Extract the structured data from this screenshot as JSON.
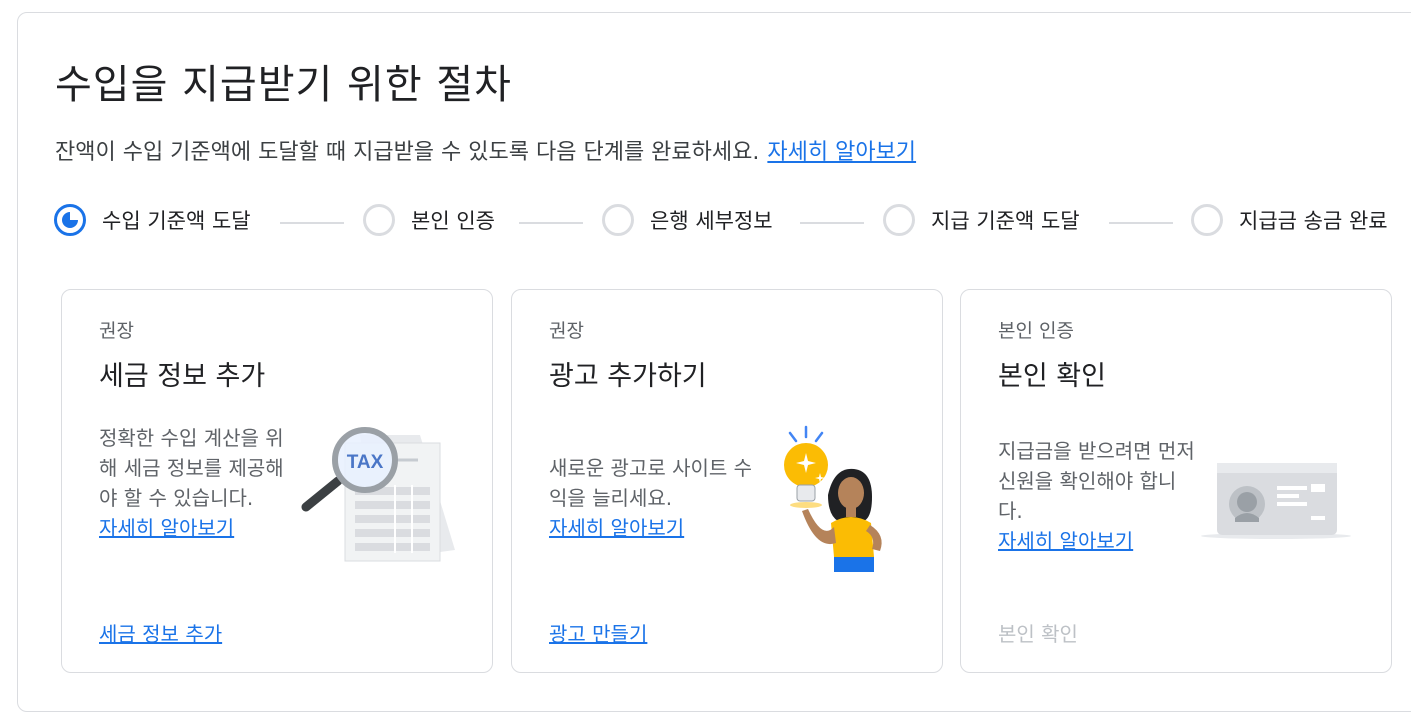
{
  "header": {
    "title": "수입을 지급받기 위한 절차",
    "subtitle": "잔액이 수입 기준액에 도달할 때 지급받을 수 있도록 다음 단계를 완료하세요.",
    "learn_more": "자세히 알아보기"
  },
  "steps": [
    {
      "label": "수입 기준액 도달",
      "state": "in-progress"
    },
    {
      "label": "본인 인증",
      "state": "pending"
    },
    {
      "label": "은행 세부정보",
      "state": "pending"
    },
    {
      "label": "지급 기준액 도달",
      "state": "pending"
    },
    {
      "label": "지급금 송금 완료",
      "state": "pending"
    }
  ],
  "cards": [
    {
      "eyebrow": "권장",
      "title": "세금 정보 추가",
      "description": "정확한 수입 계산을 위해 세금 정보를 제공해야 할 수 있습니다.",
      "learn_more": "자세히 알아보기",
      "action": "세금 정보 추가",
      "action_enabled": true,
      "illustration_icon": "tax-document-magnifier-icon",
      "illustration_text": "TAX"
    },
    {
      "eyebrow": "권장",
      "title": "광고 추가하기",
      "description": "새로운 광고로 사이트 수익을 늘리세요.",
      "learn_more": "자세히 알아보기",
      "action": "광고 만들기",
      "action_enabled": true,
      "illustration_icon": "lightbulb-person-icon"
    },
    {
      "eyebrow": "본인 인증",
      "title": "본인 확인",
      "description": "지급금을 받으려면 먼저 신원을 확인해야 합니다.",
      "learn_more": "자세히 알아보기",
      "action": "본인 확인",
      "action_enabled": false,
      "illustration_icon": "id-card-icon"
    }
  ],
  "colors": {
    "accent": "#1a73e8",
    "text_primary": "#202124",
    "text_secondary": "#5f6368",
    "border": "#dadce0",
    "disabled": "#bdc1c6"
  }
}
